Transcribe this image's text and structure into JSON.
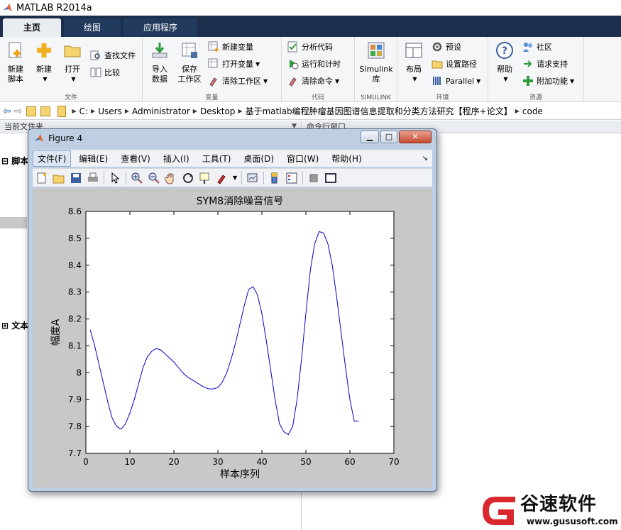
{
  "app": {
    "title": "MATLAB R2014a"
  },
  "tabs": [
    {
      "label": "主页",
      "active": true
    },
    {
      "label": "绘图",
      "active": false
    },
    {
      "label": "应用程序",
      "active": false
    }
  ],
  "ribbon": {
    "file": {
      "label": "文件",
      "new_script": "新建\n脚本",
      "new": "新建",
      "open": "打开",
      "find_files": "查找文件",
      "compare": "比较"
    },
    "variable": {
      "label": "变量",
      "import": "导入\n数据",
      "save_workspace": "保存\n工作区",
      "new_variable": "新建变量",
      "open_variable": "打开变量",
      "clear_workspace": "清除工作区"
    },
    "code": {
      "label": "代码",
      "analyze": "分析代码",
      "run_time": "运行和计时",
      "clear_commands": "清除命令"
    },
    "simulink": {
      "label": "SIMULINK",
      "library": "Simulink\n库"
    },
    "environment": {
      "label": "环境",
      "layout": "布局",
      "preferences": "预设",
      "set_path": "设置路径",
      "parallel": "Parallel"
    },
    "resources": {
      "label": "资源",
      "help": "帮助",
      "community": "社区",
      "request_support": "请求支持",
      "add_ons": "附加功能"
    }
  },
  "address": {
    "segments": [
      "C:",
      "Users",
      "Administrator",
      "Desktop",
      "基于matlab编程肿瘤基因图谱信息提取和分类方法研究【程序+论文】",
      "code"
    ]
  },
  "left_panel": {
    "title": "当前文件夹",
    "folder1": "脚本",
    "folder2": "文本"
  },
  "right_panel": {
    "title": "命令行窗口"
  },
  "figure": {
    "title": "Figure 4",
    "menu": [
      "文件(F)",
      "编辑(E)",
      "查看(V)",
      "插入(I)",
      "工具(T)",
      "桌面(D)",
      "窗口(W)",
      "帮助(H)"
    ]
  },
  "chart_data": {
    "type": "line",
    "title": "SYM8消除噪音信号",
    "xlabel": "样本序列",
    "ylabel": "幅度A",
    "xlim": [
      0,
      70
    ],
    "ylim": [
      7.7,
      8.6
    ],
    "xticks": [
      "0",
      "10",
      "20",
      "30",
      "40",
      "50",
      "60",
      "70"
    ],
    "yticks": [
      "7.7",
      "7.8",
      "7.9",
      "8",
      "8.1",
      "8.2",
      "8.3",
      "8.4",
      "8.5",
      "8.6"
    ],
    "series": [
      {
        "color": "#0000cc",
        "x": [
          1,
          2,
          3,
          4,
          5,
          6,
          7,
          8,
          9,
          10,
          11,
          12,
          13,
          14,
          15,
          16,
          17,
          18,
          19,
          20,
          21,
          22,
          23,
          24,
          25,
          26,
          27,
          28,
          29,
          30,
          31,
          32,
          33,
          34,
          35,
          36,
          37,
          38,
          39,
          40,
          41,
          42,
          43,
          44,
          45,
          46,
          47,
          48,
          49,
          50,
          51,
          52,
          53,
          54,
          55,
          56,
          57,
          58,
          59,
          60,
          61,
          62
        ],
        "y": [
          8.16,
          8.1,
          8.03,
          7.96,
          7.89,
          7.83,
          7.8,
          7.79,
          7.81,
          7.85,
          7.9,
          7.96,
          8.02,
          8.06,
          8.08,
          8.09,
          8.085,
          8.07,
          8.055,
          8.04,
          8.02,
          8.0,
          7.985,
          7.975,
          7.965,
          7.955,
          7.945,
          7.94,
          7.94,
          7.945,
          7.965,
          8.0,
          8.05,
          8.11,
          8.18,
          8.25,
          8.31,
          8.32,
          8.29,
          8.22,
          8.12,
          8.01,
          7.9,
          7.81,
          7.78,
          7.77,
          7.8,
          7.9,
          8.05,
          8.22,
          8.38,
          8.48,
          8.525,
          8.52,
          8.48,
          8.4,
          8.28,
          8.15,
          8.02,
          7.9,
          7.82,
          7.82
        ]
      }
    ],
    "grid": false
  },
  "watermark": {
    "brand": "谷速软件",
    "url": "www.gususoft.com"
  }
}
